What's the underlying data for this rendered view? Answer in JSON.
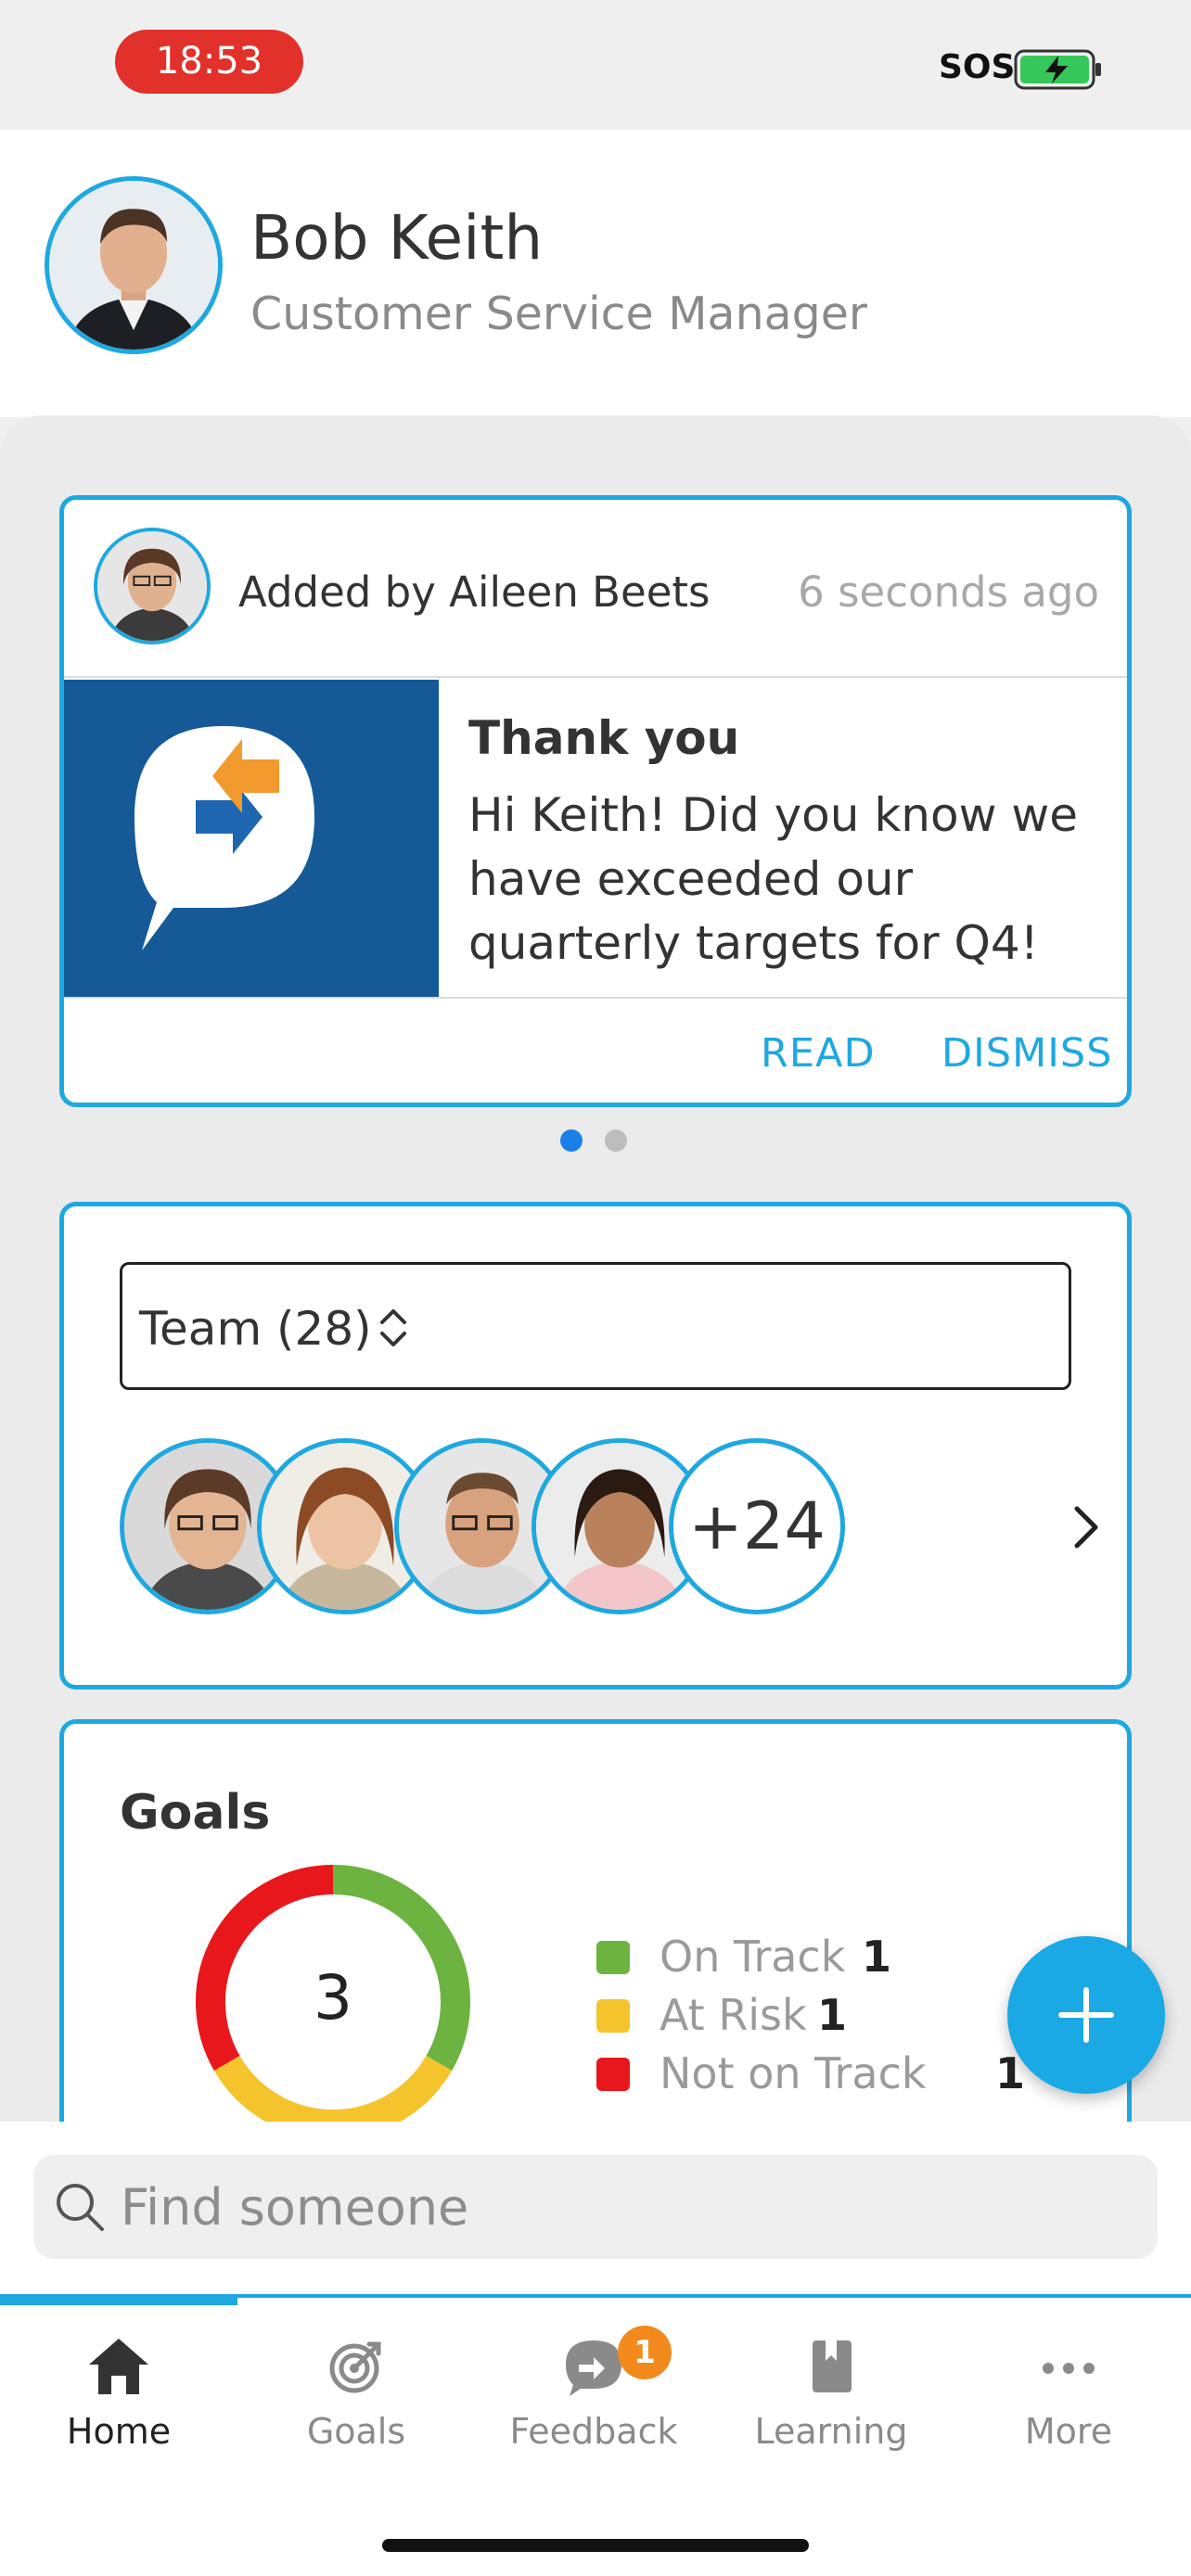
{
  "status_bar": {
    "time": "18:53",
    "sos": "SOS"
  },
  "profile": {
    "name": "Bob Keith",
    "role": "Customer Service Manager"
  },
  "announcement": {
    "added_by": "Added by Aileen Beets",
    "time_ago": "6 seconds ago",
    "title": "Thank you",
    "body": "Hi Keith! Did you know we have exceeded our quarterly targets for Q4!",
    "read_label": "READ",
    "dismiss_label": "DISMISS",
    "carousel": {
      "count": 2,
      "active": 1
    }
  },
  "team": {
    "selector_label": "Team (28)",
    "more_count": "+24"
  },
  "goals": {
    "title": "Goals",
    "total": "3",
    "legend": [
      {
        "label": "On Track",
        "value": "1",
        "color": "#6cb33f"
      },
      {
        "label": "At Risk",
        "value": "1",
        "color": "#f5c32c"
      },
      {
        "label": "Not on Track",
        "value": "1",
        "color": "#e8171b"
      }
    ]
  },
  "search": {
    "placeholder": "Find someone",
    "value": ""
  },
  "tabs": [
    {
      "label": "Home",
      "icon": "home-icon",
      "active": true
    },
    {
      "label": "Goals",
      "icon": "target-icon"
    },
    {
      "label": "Feedback",
      "icon": "feedback-icon",
      "badge": "1"
    },
    {
      "label": "Learning",
      "icon": "book-icon"
    },
    {
      "label": "More",
      "icon": "more-icon"
    }
  ],
  "colors": {
    "accent": "#1fa8e0",
    "badge": "#f28a1e",
    "time_pill": "#e2302a",
    "logo_bg": "#155a96"
  }
}
